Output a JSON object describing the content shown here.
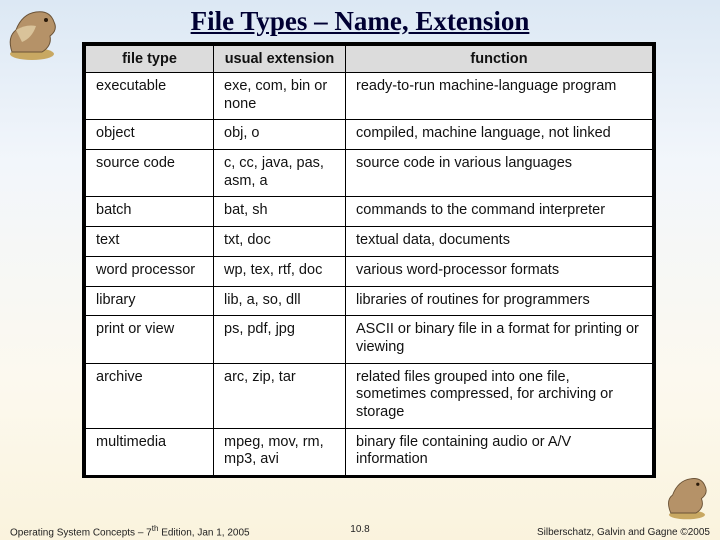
{
  "title": "File Types – Name, Extension",
  "headers": [
    "file type",
    "usual extension",
    "function"
  ],
  "rows": [
    {
      "type": "executable",
      "ext": "exe, com, bin or none",
      "func": "ready-to-run machine-language program"
    },
    {
      "type": "object",
      "ext": "obj, o",
      "func": "compiled, machine language, not linked"
    },
    {
      "type": "source code",
      "ext": "c, cc, java, pas, asm, a",
      "func": "source code in various languages"
    },
    {
      "type": "batch",
      "ext": "bat, sh",
      "func": "commands to the command interpreter"
    },
    {
      "type": "text",
      "ext": "txt, doc",
      "func": "textual data, documents"
    },
    {
      "type": "word processor",
      "ext": "wp, tex, rtf, doc",
      "func": "various word-processor formats"
    },
    {
      "type": "library",
      "ext": "lib, a, so, dll",
      "func": "libraries of routines for programmers"
    },
    {
      "type": "print or view",
      "ext": "ps, pdf, jpg",
      "func": "ASCII or binary file in a format for printing or viewing"
    },
    {
      "type": "archive",
      "ext": "arc, zip, tar",
      "func": "related files grouped into one file, sometimes compressed, for archiving or storage"
    },
    {
      "type": "multimedia",
      "ext": "mpeg, mov, rm, mp3, avi",
      "func": "binary file containing audio or A/V information"
    }
  ],
  "footer": {
    "left_pre": "Operating System Concepts – 7",
    "left_sup": "th",
    "left_post": " Edition, Jan 1, 2005",
    "center": "10.8",
    "right": "Silberschatz, Galvin and Gagne ©2005"
  },
  "chart_data": {
    "type": "table",
    "title": "File Types – Name, Extension",
    "columns": [
      "file type",
      "usual extension",
      "function"
    ],
    "rows": [
      [
        "executable",
        "exe, com, bin or none",
        "ready-to-run machine-language program"
      ],
      [
        "object",
        "obj, o",
        "compiled, machine language, not linked"
      ],
      [
        "source code",
        "c, cc, java, pas, asm, a",
        "source code in various languages"
      ],
      [
        "batch",
        "bat, sh",
        "commands to the command interpreter"
      ],
      [
        "text",
        "txt, doc",
        "textual data, documents"
      ],
      [
        "word processor",
        "wp, tex, rtf, doc",
        "various word-processor formats"
      ],
      [
        "library",
        "lib, a, so, dll",
        "libraries of routines for programmers"
      ],
      [
        "print or view",
        "ps, pdf, jpg",
        "ASCII or binary file in a format for printing or viewing"
      ],
      [
        "archive",
        "arc, zip, tar",
        "related files grouped into one file, sometimes compressed, for archiving or storage"
      ],
      [
        "multimedia",
        "mpeg, mov, rm, mp3, avi",
        "binary file containing audio or A/V information"
      ]
    ]
  }
}
